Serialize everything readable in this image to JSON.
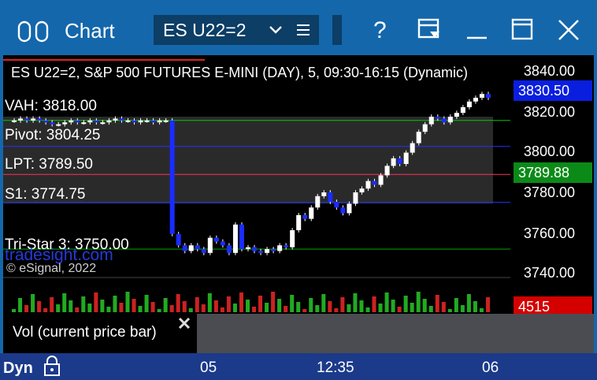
{
  "window": {
    "title": "Chart",
    "symbol": "ES U22=2",
    "colors": {
      "frame": "#1467ab",
      "symbol_box": "#0c3e66"
    }
  },
  "chart": {
    "header": "ES U22=2, S&P 500 FUTURES E-MINI (DAY), 5, 09:30-16:15 (Dynamic)",
    "copyright": "© eSignal, 2022",
    "watermark": "tradesight.com",
    "levels": [
      {
        "label": "VAH: 3818.00"
      },
      {
        "label": "Pivot: 3804.25"
      },
      {
        "label": "LPT: 3789.50"
      },
      {
        "label": "S1: 3774.75"
      },
      {
        "label": "Tri-Star 3: 3750.00"
      }
    ],
    "axis_labels": [
      "3840.00",
      "3820.00",
      "3800.00",
      "3780.00",
      "3760.00",
      "3740.00"
    ],
    "last_price_tag": "3830.50",
    "lpt_tag": "3789.88",
    "volume_tag": "4515",
    "volume_popup": "Vol (current price bar)",
    "time_labels": [
      "05",
      "12:35",
      "06"
    ],
    "bottom_mode": "Dyn"
  },
  "chart_data": {
    "type": "candlestick",
    "ylim": [
      3735,
      3845
    ],
    "levels": {
      "VAH": 3818.0,
      "Pivot": 3804.25,
      "LPT": 3789.5,
      "S1": 3774.75,
      "Tri-Star 3": 3750.0
    },
    "last_price": 3830.5,
    "lpt_value": 3789.88,
    "volume_last": 4515,
    "closes": [
      3818,
      3819,
      3818,
      3819,
      3818,
      3817,
      3816,
      3816,
      3817,
      3818,
      3817,
      3817,
      3818,
      3817,
      3817,
      3818,
      3819,
      3818,
      3818,
      3817,
      3818,
      3818,
      3817,
      3818,
      3818,
      3758,
      3752,
      3749,
      3752,
      3750,
      3748,
      3756,
      3754,
      3752,
      3748,
      3763,
      3750,
      3751,
      3749,
      3748,
      3750,
      3749,
      3752,
      3751,
      3760,
      3768,
      3766,
      3772,
      3778,
      3780,
      3775,
      3772,
      3769,
      3774,
      3780,
      3782,
      3786,
      3784,
      3789,
      3794,
      3798,
      3795,
      3801,
      3806,
      3812,
      3816,
      3820,
      3819,
      3817,
      3820,
      3822,
      3825,
      3828,
      3830,
      3832,
      3830
    ]
  }
}
